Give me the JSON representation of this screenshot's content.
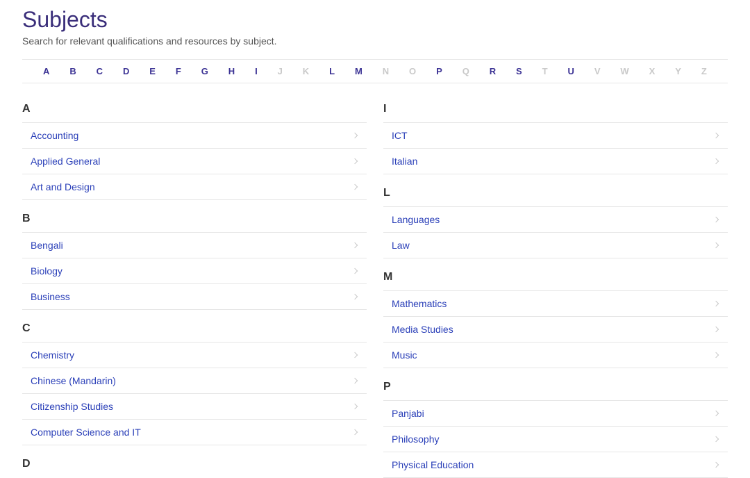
{
  "header": {
    "title": "Subjects",
    "subtitle": "Search for relevant qualifications and resources by subject."
  },
  "alphaNav": [
    {
      "letter": "A",
      "active": true
    },
    {
      "letter": "B",
      "active": true
    },
    {
      "letter": "C",
      "active": true
    },
    {
      "letter": "D",
      "active": true
    },
    {
      "letter": "E",
      "active": true
    },
    {
      "letter": "F",
      "active": true
    },
    {
      "letter": "G",
      "active": true
    },
    {
      "letter": "H",
      "active": true
    },
    {
      "letter": "I",
      "active": true
    },
    {
      "letter": "J",
      "active": false
    },
    {
      "letter": "K",
      "active": false
    },
    {
      "letter": "L",
      "active": true
    },
    {
      "letter": "M",
      "active": true
    },
    {
      "letter": "N",
      "active": false
    },
    {
      "letter": "O",
      "active": false
    },
    {
      "letter": "P",
      "active": true
    },
    {
      "letter": "Q",
      "active": false
    },
    {
      "letter": "R",
      "active": true
    },
    {
      "letter": "S",
      "active": true
    },
    {
      "letter": "T",
      "active": false
    },
    {
      "letter": "U",
      "active": true
    },
    {
      "letter": "V",
      "active": false
    },
    {
      "letter": "W",
      "active": false
    },
    {
      "letter": "X",
      "active": false
    },
    {
      "letter": "Y",
      "active": false
    },
    {
      "letter": "Z",
      "active": false
    }
  ],
  "leftColumn": [
    {
      "letter": "A",
      "items": [
        "Accounting",
        "Applied General",
        "Art and Design"
      ]
    },
    {
      "letter": "B",
      "items": [
        "Bengali",
        "Biology",
        "Business"
      ]
    },
    {
      "letter": "C",
      "items": [
        "Chemistry",
        "Chinese (Mandarin)",
        "Citizenship Studies",
        "Computer Science and IT"
      ]
    },
    {
      "letter": "D",
      "items": []
    }
  ],
  "rightColumn": [
    {
      "letter": "I",
      "items": [
        "ICT",
        "Italian"
      ]
    },
    {
      "letter": "L",
      "items": [
        "Languages",
        "Law"
      ]
    },
    {
      "letter": "M",
      "items": [
        "Mathematics",
        "Media Studies",
        "Music"
      ]
    },
    {
      "letter": "P",
      "items": [
        "Panjabi",
        "Philosophy",
        "Physical Education"
      ]
    }
  ]
}
